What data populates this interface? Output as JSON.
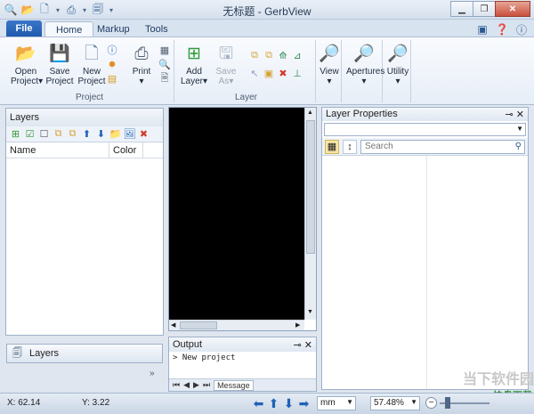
{
  "window": {
    "title": "无标题 - GerbView"
  },
  "tabs": {
    "file": "File",
    "home": "Home",
    "markup": "Markup",
    "tools": "Tools"
  },
  "ribbon": {
    "project_group": "Project",
    "layer_group": "Layer",
    "open_project": [
      "Open",
      "Project"
    ],
    "save_project": [
      "Save",
      "Project"
    ],
    "new_project": [
      "New",
      "Project"
    ],
    "print": "Print",
    "add_layer": [
      "Add",
      "Layer"
    ],
    "save_as": [
      "Save",
      "As"
    ],
    "view": "View",
    "apertures": "Apertures",
    "utility": "Utility"
  },
  "layers_pane": {
    "title": "Layers",
    "columns": [
      "Name",
      "Color"
    ],
    "tab_label": "Layers"
  },
  "output_pane": {
    "title": "Output",
    "log": "> New project",
    "tab_label": "Message"
  },
  "props_pane": {
    "title": "Layer Properties",
    "search_placeholder": "Search"
  },
  "status": {
    "x": "X: 62.14",
    "y": "Y: 3.22",
    "units": "mm",
    "zoom": "57.48%"
  },
  "watermark": {
    "main": "当下软件园",
    "sub": "快盘下载"
  },
  "colors": {
    "accent": "#1e58ab",
    "canvas": "#000000"
  }
}
